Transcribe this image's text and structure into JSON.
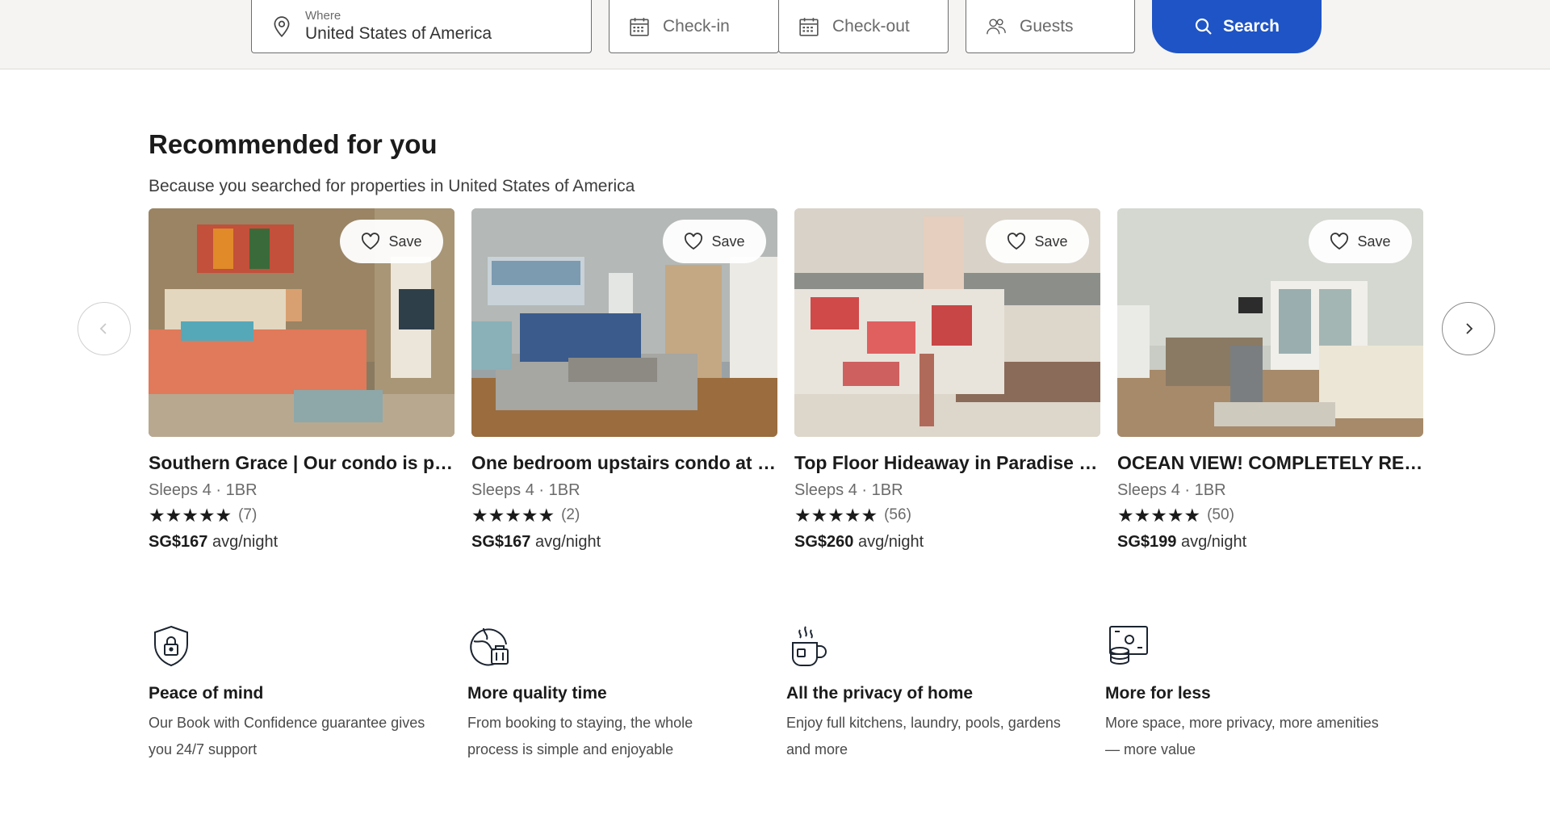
{
  "search": {
    "where_label": "Where",
    "where_value": "United States of America",
    "checkin_placeholder": "Check-in",
    "checkout_placeholder": "Check-out",
    "guests_placeholder": "Guests",
    "search_label": "Search",
    "accent_color": "#1e54c5"
  },
  "recommended": {
    "title": "Recommended for you",
    "subtitle": "Because you searched for properties in United States of America",
    "save_label": "Save",
    "cards": [
      {
        "title": "Southern Grace | Our condo is perfect",
        "meta": "Sleeps 4 · 1BR",
        "stars": "★★★★★",
        "reviews": "(7)",
        "price": "SG$167",
        "price_suffix": "avg/night",
        "image": "bedroom-photo"
      },
      {
        "title": "One bedroom upstairs condo at the beach",
        "meta": "Sleeps 4 · 1BR",
        "stars": "★★★★★",
        "reviews": "(2)",
        "price": "SG$167",
        "price_suffix": "avg/night",
        "image": "living-room-photo"
      },
      {
        "title": "Top Floor Hideaway in Paradise by the sea",
        "meta": "Sleeps 4 · 1BR",
        "stars": "★★★★★",
        "reviews": "(56)",
        "price": "SG$260",
        "price_suffix": "avg/night",
        "image": "beach-painting-photo"
      },
      {
        "title": "OCEAN VIEW! COMPLETELY REMODELED",
        "meta": "Sleeps 4 · 1BR",
        "stars": "★★★★★",
        "reviews": "(50)",
        "price": "SG$199",
        "price_suffix": "avg/night",
        "image": "open-living-photo"
      }
    ]
  },
  "benefits": [
    {
      "icon": "shield-lock-icon",
      "title": "Peace of mind",
      "desc_line1": "Our Book with Confidence guarantee gives",
      "desc_line2": "you 24/7 support"
    },
    {
      "icon": "globe-suitcase-icon",
      "title": "More quality time",
      "desc_line1": "From booking to staying, the whole",
      "desc_line2": "process is simple and enjoyable"
    },
    {
      "icon": "coffee-cup-icon",
      "title": "All the privacy of home",
      "desc_line1": "Enjoy full kitchens, laundry, pools, gardens",
      "desc_line2": "and more"
    },
    {
      "icon": "money-coins-icon",
      "title": "More for less",
      "desc_line1": "More space, more privacy, more amenities",
      "desc_line2": "— more value"
    }
  ]
}
